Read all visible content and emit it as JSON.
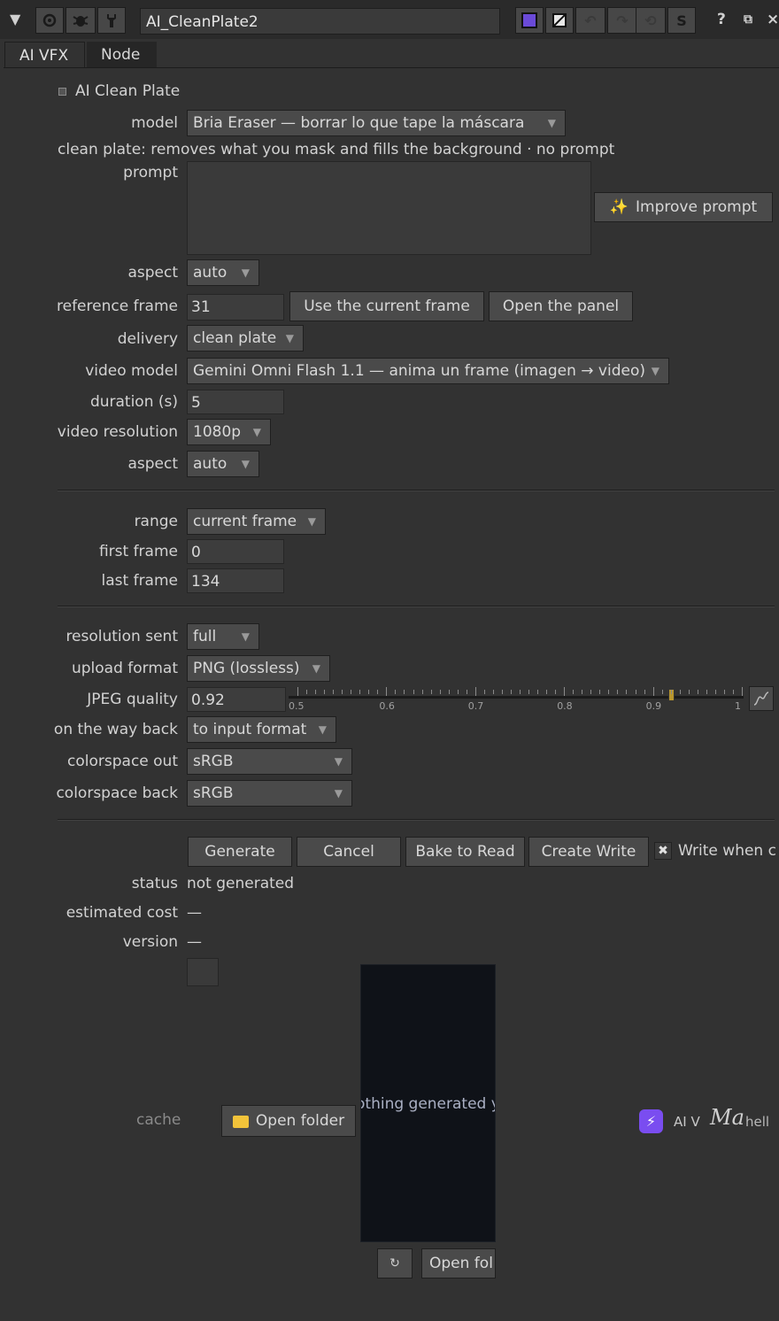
{
  "toolbar": {
    "node_name": "AI_CleanPlate2",
    "s_label": "S",
    "help_label": "?",
    "close_label": "×"
  },
  "tabs": [
    "AI VFX",
    "Node"
  ],
  "section": {
    "title": "AI Clean Plate"
  },
  "form": {
    "model_label": "model",
    "model_value": "Bria Eraser — borrar lo que tape la máscara",
    "model_info": "clean plate: removes what you mask and fills the background · no prompt",
    "prompt_label": "prompt",
    "prompt_value": "",
    "improve_prompt": "Improve prompt",
    "aspect_label": "aspect",
    "aspect_value": "auto",
    "ref_frame_label": "reference frame",
    "ref_frame_value": "31",
    "use_current_frame": "Use the current frame",
    "open_panel": "Open the panel",
    "delivery_label": "delivery",
    "delivery_value": "clean plate",
    "video_model_label": "video model",
    "video_model_value": "Gemini Omni Flash 1.1 — anima un frame (imagen → video)",
    "duration_label": "duration (s)",
    "duration_value": "5",
    "video_res_label": "video resolution",
    "video_res_value": "1080p",
    "aspect2_label": "aspect",
    "aspect2_value": "auto",
    "range_label": "range",
    "range_value": "current frame",
    "first_frame_label": "first frame",
    "first_frame_value": "0",
    "last_frame_label": "last frame",
    "last_frame_value": "134",
    "res_sent_label": "resolution sent",
    "res_sent_value": "full",
    "upload_format_label": "upload format",
    "upload_format_value": "PNG (lossless)",
    "jpeg_label": "JPEG quality",
    "jpeg_value": "0.92",
    "jpeg_slider_value": 0.92,
    "slider_ticks": [
      "0.5",
      "0.6",
      "0.7",
      "0.8",
      "0.9",
      "1"
    ],
    "way_back_label": "on the way back",
    "way_back_value": "to input format",
    "cs_out_label": "colorspace out",
    "cs_out_value": "sRGB",
    "cs_back_label": "colorspace back",
    "cs_back_value": "sRGB"
  },
  "actions": {
    "generate": "Generate",
    "cancel": "Cancel",
    "bake": "Bake to Read",
    "create_write": "Create Write",
    "write_when": "Write when c",
    "write_when_checked": true
  },
  "status": {
    "status_label": "status",
    "status_value": "not generated",
    "cost_label": "estimated cost",
    "cost_value": "—",
    "version_label": "version",
    "version_value": "—"
  },
  "preview": {
    "empty_text": "othing generated y",
    "open_folder_small": "Open fol"
  },
  "cache": {
    "label": "cache",
    "open_folder": "Open folder"
  },
  "brand": {
    "ai_label": "AI V",
    "logo_text": "Ma",
    "hello": "hell",
    "accent": "#7a4df0"
  }
}
